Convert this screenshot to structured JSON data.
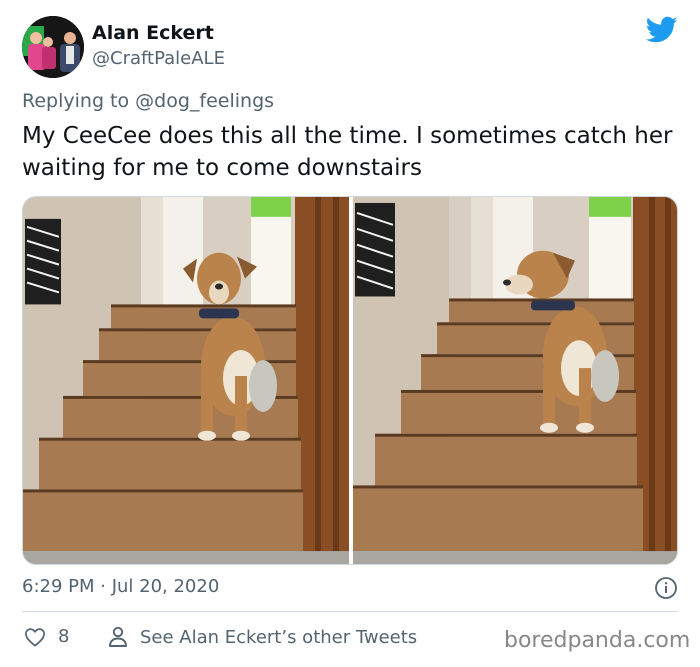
{
  "author": {
    "display_name": "Alan Eckert",
    "handle": "@CraftPaleALE"
  },
  "reply": {
    "prefix": "Replying to",
    "to": "@dog_feelings"
  },
  "tweet": {
    "text": "My CeeCee does this all the time. I sometimes catch her waiting for me to come downstairs"
  },
  "meta": {
    "timestamp": "6:29 PM · Jul 20, 2020",
    "like_count": "8",
    "other_tweets_label": "See Alan Eckert’s other Tweets"
  },
  "watermark": "boredpanda.com",
  "icons": {
    "brand": "twitter-bird-icon",
    "info": "info-icon",
    "like": "heart-icon",
    "profile": "person-icon"
  },
  "colors": {
    "twitter_blue": "#1d9bf0",
    "secondary_text": "#536471",
    "primary_text": "#0f1419"
  }
}
